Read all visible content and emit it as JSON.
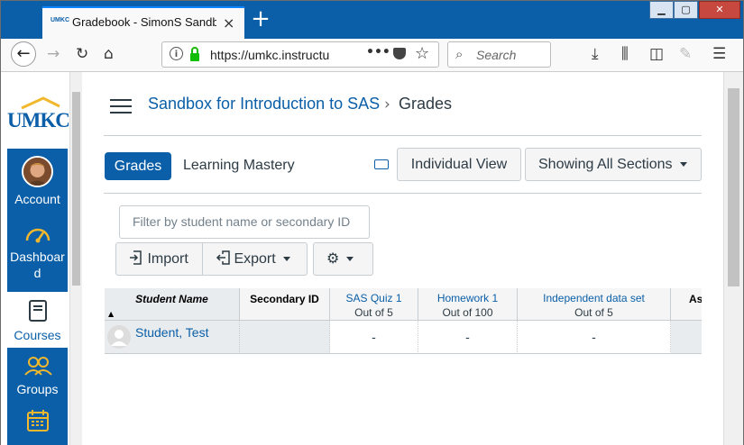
{
  "browser": {
    "tab_title": "Gradebook - SimonS Sandbox",
    "tab_favicon_text": "UMKC",
    "new_tab": "+",
    "url_host": "https://umkc.",
    "url_rest": "instructu",
    "url_more": "•••",
    "search_placeholder": "Search",
    "window_controls": {
      "minimize": "▁",
      "maximize": "▢",
      "close": "✕"
    }
  },
  "sidebar": {
    "logo": "UMKC",
    "items": [
      {
        "label": "Account",
        "icon": "avatar"
      },
      {
        "label": "Dashboard",
        "icon": "dashboard-icon"
      },
      {
        "label": "Courses",
        "icon": "courses-icon",
        "active": true
      },
      {
        "label": "Groups",
        "icon": "groups-icon"
      },
      {
        "label": "",
        "icon": "calendar-icon"
      }
    ]
  },
  "header": {
    "course": "Sandbox for Introduction to SAS",
    "separator": "›",
    "current": "Grades"
  },
  "tabs": {
    "grades": "Grades",
    "learning_mastery": "Learning Mastery"
  },
  "buttons": {
    "individual_view": "Individual View",
    "sections": "Showing All Sections",
    "import": "Import",
    "export": "Export"
  },
  "filter": {
    "placeholder": "Filter by student name or secondary ID"
  },
  "grid": {
    "columns": [
      {
        "title": "Student Name",
        "sub": "▲"
      },
      {
        "title": "Secondary ID",
        "sub": ""
      },
      {
        "title": "SAS Quiz 1",
        "sub": "Out of 5"
      },
      {
        "title": "Homework 1",
        "sub": "Out of 100"
      },
      {
        "title": "Independent data set",
        "sub": "Out of 5"
      },
      {
        "title": "As",
        "sub": ""
      }
    ],
    "rows": [
      {
        "student": "Student, Test",
        "secondary_id": "",
        "quiz1": "-",
        "hw1": "-",
        "ids": "-",
        "as": ""
      }
    ]
  },
  "colors": {
    "brand": "#0a5fa8",
    "titlebar": "#0a5fa8"
  }
}
